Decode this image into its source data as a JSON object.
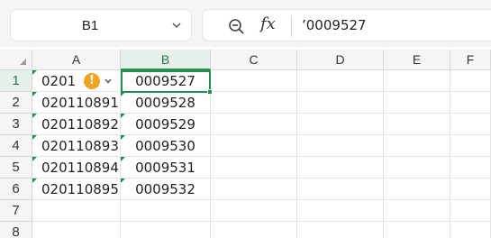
{
  "name_box": {
    "value": "B1"
  },
  "formula_bar": {
    "fx_label": "fx",
    "value": "’0009527"
  },
  "columns": [
    "A",
    "B",
    "C",
    "D",
    "E",
    "F"
  ],
  "rows": [
    "1",
    "2",
    "3",
    "4",
    "5",
    "6",
    "7",
    "8"
  ],
  "cells": {
    "A": [
      "0201",
      "020110891",
      "020110892",
      "020110893",
      "020110894",
      "020110895"
    ],
    "B": [
      "0009527",
      "0009528",
      "0009529",
      "0009530",
      "0009531",
      "0009532"
    ]
  },
  "selection": {
    "active_cell": "B1"
  },
  "colors": {
    "accent": "#1f8f4e",
    "warning": "#f2a320"
  },
  "icons": {
    "name_box_dropdown": "chevron-down-icon",
    "zoom": "zoom-icon",
    "warning": "warning-icon"
  }
}
